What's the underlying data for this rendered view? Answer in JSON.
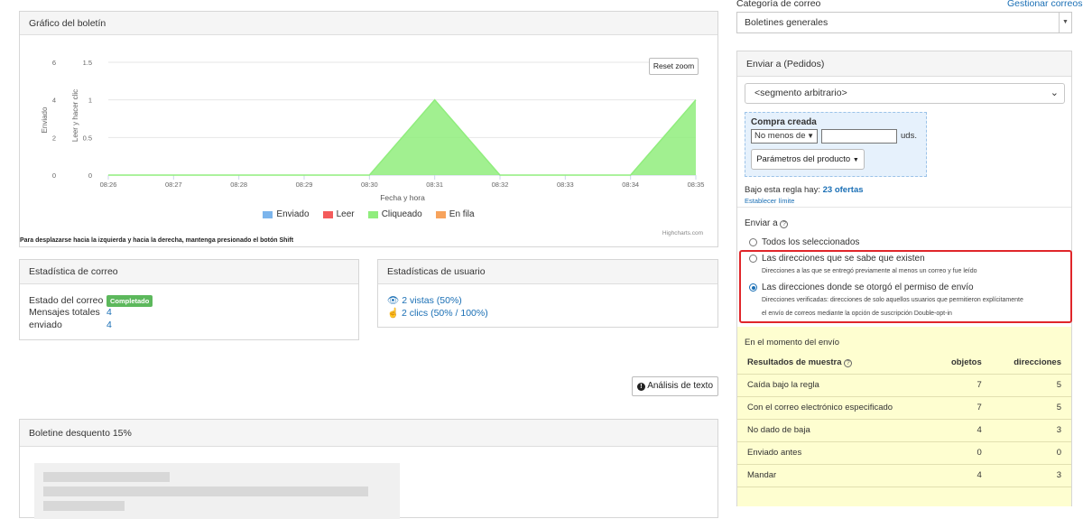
{
  "chart_panel": {
    "title": "Gráfico del boletín",
    "reset_zoom": "Reset zoom",
    "credits": "Highcharts.com",
    "hint": "Para desplazarse hacia la izquierda y hacia la derecha, mantenga presionado el botón Shift"
  },
  "chart_data": {
    "type": "area",
    "x": [
      "08:26",
      "08:27",
      "08:28",
      "08:29",
      "08:30",
      "08:31",
      "08:32",
      "08:33",
      "08:34",
      "08:35"
    ],
    "xlabel": "Fecha y hora",
    "y_left": {
      "label": "Enviado",
      "ticks": [
        "0",
        "2",
        "4",
        "6"
      ],
      "range": [
        0,
        6
      ]
    },
    "y_right": {
      "label": "Leer y hacer clic",
      "ticks": [
        "0",
        "0.5",
        "1",
        "1.5"
      ],
      "range": [
        0,
        1.5
      ]
    },
    "series": [
      {
        "name": "Enviado",
        "color": "#7cb5ec",
        "values": [
          0,
          0,
          0,
          0,
          0,
          0,
          0,
          0,
          0,
          0
        ]
      },
      {
        "name": "Leer",
        "color": "#f45b5b",
        "values": [
          0,
          0,
          0,
          0,
          0,
          0,
          0,
          0,
          0,
          0
        ]
      },
      {
        "name": "Cliqueado",
        "color": "#90ed7d",
        "values": [
          0,
          0,
          0,
          0,
          0,
          1,
          0,
          0,
          0,
          1
        ]
      },
      {
        "name": "En fila",
        "color": "#f7a35c",
        "values": [
          0,
          0,
          0,
          0,
          0,
          0,
          0,
          0,
          0,
          0
        ]
      }
    ]
  },
  "mail_stats": {
    "title": "Estadística de correo",
    "rows": [
      {
        "label": "Estado del correo",
        "badge": "Completado"
      },
      {
        "label": "Mensajes totales",
        "value": "4"
      },
      {
        "label": "enviado",
        "value": "4"
      }
    ]
  },
  "user_stats": {
    "title": "Estadísticas de usuario",
    "views": "2 vistas (50%)",
    "clicks": "2 clics (50% / 100%)"
  },
  "text_analysis_button": "Análisis de texto",
  "newsletter_panel": {
    "title": "Boletine desquento 15%"
  },
  "sidebar": {
    "category_label": "Categoría de correo",
    "manage_link": "Gestionar correos",
    "category_value": "Boletines generales",
    "send_to_panel": {
      "title": "Enviar a (Pedidos)",
      "segment_value": "<segmento arbitrario>",
      "purchase": {
        "title": "Compra creada",
        "operator": "No menos de",
        "quantity": "",
        "unit": "uds.",
        "params_button": "Parámetros del producto"
      },
      "rule_text": "Bajo esta regla hay:",
      "rule_count": "23 ofertas",
      "set_limit": "Establecer límite",
      "send_to_label": "Enviar a",
      "options": [
        {
          "label": "Todos los seleccionados",
          "desc": "",
          "checked": false
        },
        {
          "label": "Las direcciones que se sabe que existen",
          "desc": "Direcciones a las que se entregó previamente al menos un correo y fue leído",
          "checked": false
        },
        {
          "label": "Las direcciones donde se otorgó el permiso de envío",
          "desc": "Direcciones verificadas: direcciones de solo aquellos usuarios que permitieron explícitamente",
          "desc2": "el envío de correos mediante la opción de suscripción Double-opt-in",
          "checked": true
        }
      ],
      "moment_label": "En el momento del envío",
      "results": {
        "headers": [
          "Resultados de muestra",
          "objetos",
          "direcciones"
        ],
        "rows": [
          [
            "Caída bajo la regla",
            "7",
            "5"
          ],
          [
            "Con el correo electrónico especificado",
            "7",
            "5"
          ],
          [
            "No dado de baja",
            "4",
            "3"
          ],
          [
            "Enviado antes",
            "0",
            "0"
          ],
          [
            "Mandar",
            "4",
            "3"
          ]
        ]
      }
    }
  },
  "colors": {
    "accent": "#1a6fb5",
    "highlight": "#e0262a",
    "success": "#5cb85c",
    "yellow_bg": "#fefed0",
    "blue_bg": "#e6f1fc"
  }
}
